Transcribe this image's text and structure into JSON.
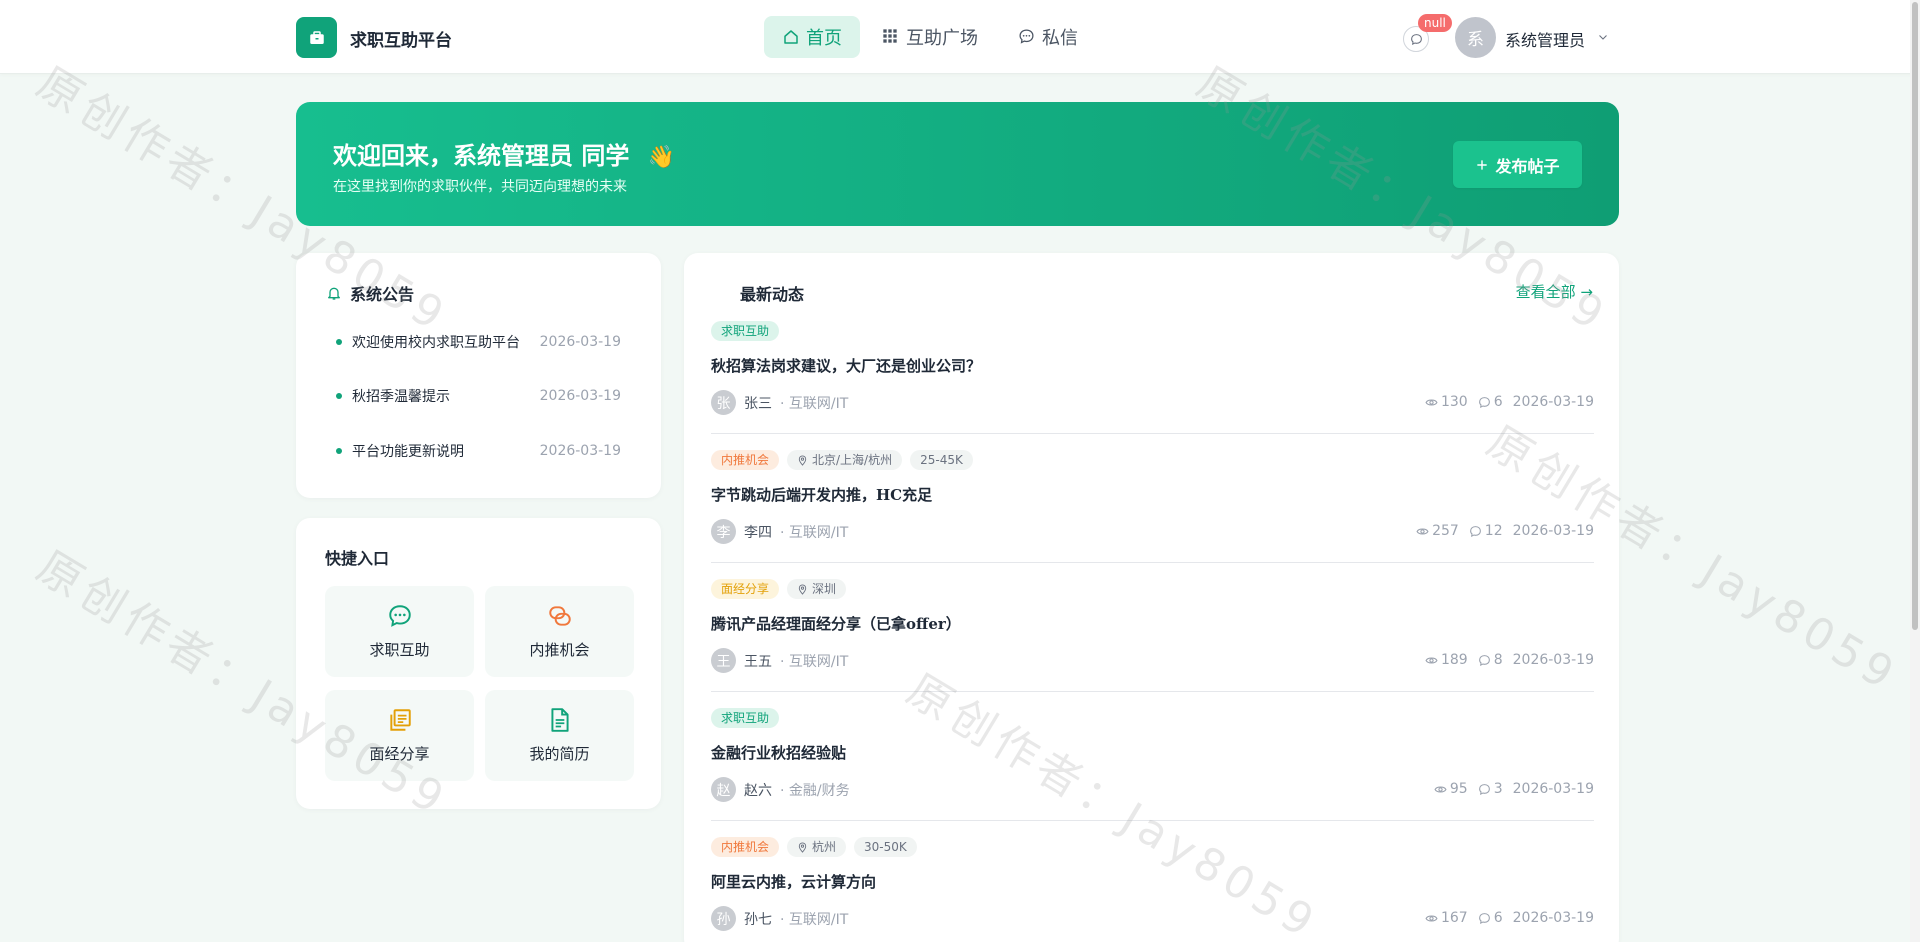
{
  "app": {
    "title": "求职互助平台"
  },
  "nav": {
    "items": [
      {
        "label": "首页",
        "icon": "home-icon",
        "active": true
      },
      {
        "label": "互助广场",
        "icon": "grid-icon",
        "active": false
      },
      {
        "label": "私信",
        "icon": "chat-icon",
        "active": false
      }
    ]
  },
  "header": {
    "message_badge": "null",
    "avatar_char": "系",
    "user_name": "系统管理员"
  },
  "banner": {
    "title": "欢迎回来，系统管理员 同学",
    "emoji": "👋",
    "subtitle": "在这里找到你的求职伙伴，共同迈向理想的未来",
    "publish_label": "发布帖子"
  },
  "announcements": {
    "title": "系统公告",
    "items": [
      {
        "text": "欢迎使用校内求职互助平台",
        "date": "2026-03-19"
      },
      {
        "text": "秋招季温馨提示",
        "date": "2026-03-19"
      },
      {
        "text": "平台功能更新说明",
        "date": "2026-03-19"
      }
    ]
  },
  "quick": {
    "title": "快捷入口",
    "items": [
      {
        "label": "求职互助",
        "icon": "chat-bubble-icon",
        "color": "#10a37a"
      },
      {
        "label": "内推机会",
        "icon": "link-icon",
        "color": "#f0783c"
      },
      {
        "label": "面经分享",
        "icon": "copy-icon",
        "color": "#e3a008"
      },
      {
        "label": "我的简历",
        "icon": "document-icon",
        "color": "#10a37a"
      }
    ]
  },
  "feed": {
    "title": "最新动态",
    "view_all": "查看全部 →",
    "posts": [
      {
        "category": "求职互助",
        "category_style": "green",
        "location": "",
        "salary": "",
        "title": "秋招算法岗求建议，大厂还是创业公司？",
        "avatar": "张",
        "author": "张三",
        "industry": "· 互联网/IT",
        "views": "130",
        "comments": "6",
        "date": "2026-03-19"
      },
      {
        "category": "内推机会",
        "category_style": "orange",
        "location": "北京/上海/杭州",
        "salary": "25-45K",
        "title": "字节跳动后端开发内推，HC充足",
        "avatar": "李",
        "author": "李四",
        "industry": "· 互联网/IT",
        "views": "257",
        "comments": "12",
        "date": "2026-03-19"
      },
      {
        "category": "面经分享",
        "category_style": "yellow",
        "location": "深圳",
        "salary": "",
        "title": "腾讯产品经理面经分享（已拿offer）",
        "avatar": "王",
        "author": "王五",
        "industry": "· 互联网/IT",
        "views": "189",
        "comments": "8",
        "date": "2026-03-19"
      },
      {
        "category": "求职互助",
        "category_style": "green",
        "location": "",
        "salary": "",
        "title": "金融行业秋招经验贴",
        "avatar": "赵",
        "author": "赵六",
        "industry": "· 金融/财务",
        "views": "95",
        "comments": "3",
        "date": "2026-03-19"
      },
      {
        "category": "内推机会",
        "category_style": "orange",
        "location": "杭州",
        "salary": "30-50K",
        "title": "阿里云内推，云计算方向",
        "avatar": "孙",
        "author": "孙七",
        "industry": "· 互联网/IT",
        "views": "167",
        "comments": "6",
        "date": "2026-03-19"
      }
    ]
  },
  "watermark": "原创作者：Jay8059"
}
